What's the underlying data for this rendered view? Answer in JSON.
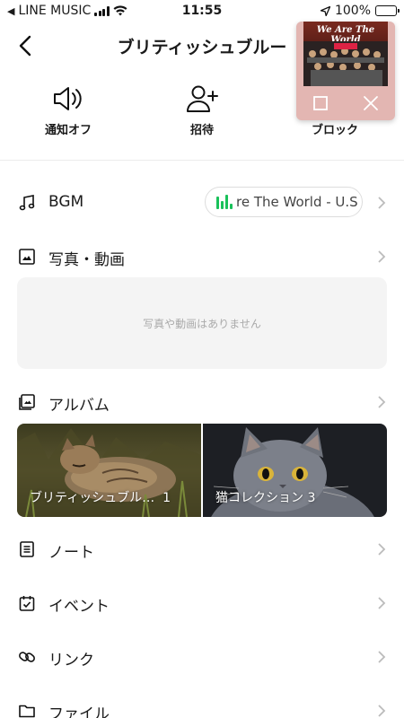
{
  "status_bar": {
    "carrier": "LINE MUSIC",
    "time": "11:55",
    "battery": "100%"
  },
  "header": {
    "title": "ブリティッシュブルー"
  },
  "actions": [
    {
      "label": "通知オフ",
      "icon": "speaker-icon"
    },
    {
      "label": "招待",
      "icon": "add-user-icon"
    },
    {
      "label": "ブロック",
      "icon": "block-icon"
    }
  ],
  "bgm": {
    "label": "BGM",
    "track_text": "re The World - U.S"
  },
  "photos": {
    "label": "写真・動画",
    "empty_text": "写真や動画はありません"
  },
  "album_section": {
    "label": "アルバム",
    "albums": [
      {
        "name": "ブリティッシュブル…",
        "count": "1"
      },
      {
        "name": "猫コレクション",
        "count": "3"
      }
    ]
  },
  "menu": [
    {
      "label": "ノート",
      "icon": "note-icon"
    },
    {
      "label": "イベント",
      "icon": "calendar-icon"
    },
    {
      "label": "リンク",
      "icon": "link-icon"
    },
    {
      "label": "ファイル",
      "icon": "folder-icon"
    }
  ],
  "mini_player": {
    "cover_title": "We Are The World"
  },
  "colors": {
    "accent_green": "#19c15a",
    "battery_green": "#4cd964",
    "mini_player_bg": "#e3b6b2"
  }
}
